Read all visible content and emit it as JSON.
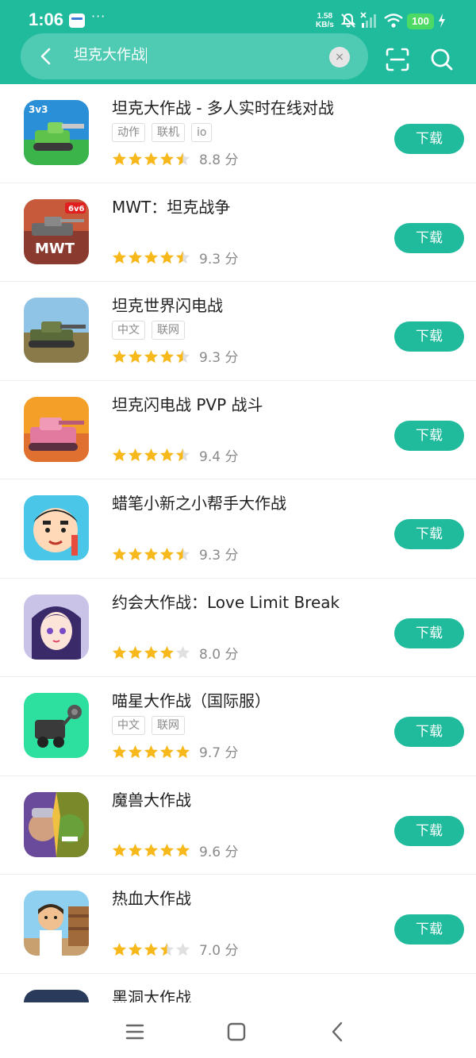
{
  "status_bar": {
    "time": "1:06",
    "dots": "···",
    "net_speed_value": "1.58",
    "net_speed_unit": "KB/s",
    "battery": "100"
  },
  "search": {
    "query": "坦克大作战",
    "clear_symbol": "×"
  },
  "download_label": "下载",
  "colors": {
    "accent": "#20bb9d",
    "star_on": "#f7b81c",
    "star_off": "#e0e0e0"
  },
  "apps": [
    {
      "name": "坦克大作战 - 多人实时在线对战",
      "tags": [
        "动作",
        "联机",
        "io"
      ],
      "stars": 4.5,
      "score": "8.8 分",
      "icon": "tank-3v3-icon"
    },
    {
      "name": "MWT：坦克战争",
      "tags": [],
      "stars": 4.5,
      "score": "9.3 分",
      "icon": "mwt-tank-icon"
    },
    {
      "name": "坦克世界闪电战",
      "tags": [
        "中文",
        "联网"
      ],
      "stars": 4.5,
      "score": "9.3 分",
      "icon": "world-of-tanks-icon"
    },
    {
      "name": "坦克闪电战 PVP 战斗",
      "tags": [],
      "stars": 4.5,
      "score": "9.4 分",
      "icon": "pink-tank-icon"
    },
    {
      "name": "蜡笔小新之小帮手大作战",
      "tags": [],
      "stars": 4.5,
      "score": "9.3 分",
      "icon": "crayon-shin-chan-icon"
    },
    {
      "name": "约会大作战：Love Limit Break",
      "tags": [],
      "stars": 4,
      "score": "8.0 分",
      "icon": "anime-girl-icon"
    },
    {
      "name": "喵星大作战（国际服）",
      "tags": [
        "中文",
        "联网"
      ],
      "stars": 5,
      "score": "9.7 分",
      "icon": "cat-robot-icon"
    },
    {
      "name": "魔兽大作战",
      "tags": [],
      "stars": 5,
      "score": "9.6 分",
      "icon": "warcraft-rumble-icon"
    },
    {
      "name": "热血大作战",
      "tags": [],
      "stars": 3.5,
      "score": "7.0 分",
      "icon": "fighter-guy-icon"
    },
    {
      "name": "黑洞大作战",
      "tags": [],
      "stars": 0,
      "score": "",
      "icon": "black-hole-icon"
    }
  ]
}
